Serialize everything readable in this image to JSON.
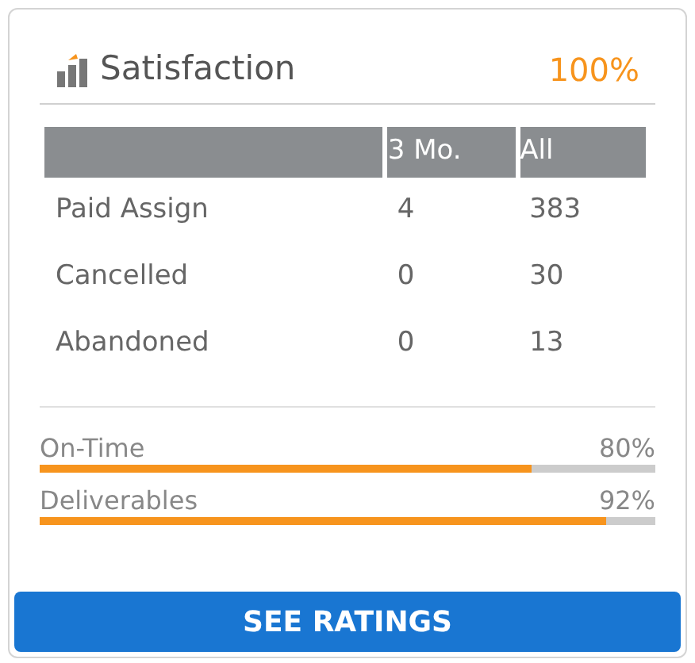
{
  "title": "Satisfaction",
  "score": "100%",
  "table": {
    "columns": [
      "",
      "3 Mo.",
      "All"
    ],
    "rows": [
      [
        "Paid Assign",
        "4",
        "383"
      ],
      [
        "Cancelled",
        "0",
        "30"
      ],
      [
        "Abandoned",
        "0",
        "13"
      ]
    ]
  },
  "meters": [
    {
      "label": "On-Time",
      "reading": "80%",
      "level": 0.8
    },
    {
      "label": "Deliverables",
      "reading": "92%",
      "level": 0.92
    }
  ],
  "button": "SEE RATINGS"
}
